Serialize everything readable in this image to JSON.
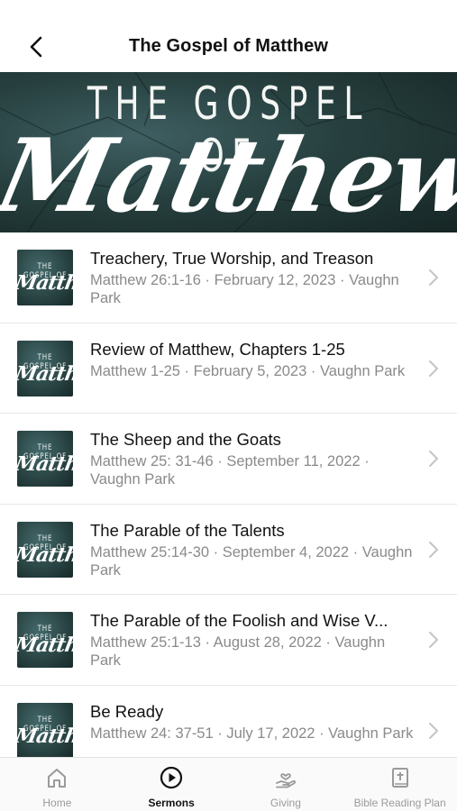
{
  "header": {
    "title": "The Gospel of Matthew",
    "back_icon": "chevron-left-icon"
  },
  "hero": {
    "line1": "THE GOSPEL OF",
    "line2": "Matthew"
  },
  "thumbnail": {
    "line1": "THE GOSPEL OF",
    "line2": "Matthew"
  },
  "sermons": [
    {
      "title": "Treachery, True Worship, and Treason",
      "meta": "Matthew 26:1-16 · February 12, 2023 · Vaughn Park"
    },
    {
      "title": "Review of Matthew, Chapters 1-25",
      "meta": "Matthew 1-25 · February 5, 2023 · Vaughn Park"
    },
    {
      "title": "The Sheep and the Goats",
      "meta": "Matthew 25: 31-46 · September 11, 2022 · Vaughn Park"
    },
    {
      "title": "The Parable of the Talents",
      "meta": "Matthew 25:14-30 · September 4, 2022 · Vaughn Park"
    },
    {
      "title": "The Parable of the Foolish and Wise V...",
      "meta": "Matthew 25:1-13 · August 28, 2022 · Vaughn Park"
    },
    {
      "title": "Be Ready",
      "meta": "Matthew 24: 37-51 · July 17, 2022 · Vaughn Park"
    }
  ],
  "tabs": [
    {
      "label": "Home",
      "icon": "home-icon"
    },
    {
      "label": "Sermons",
      "icon": "play-circle-icon",
      "active": true
    },
    {
      "label": "Giving",
      "icon": "giving-hand-icon"
    },
    {
      "label": "Bible Reading Plan",
      "icon": "bible-icon"
    }
  ],
  "colors": {
    "accent": "#111111",
    "inactive": "#9a9a9a",
    "hero_bg": "#27403f"
  }
}
